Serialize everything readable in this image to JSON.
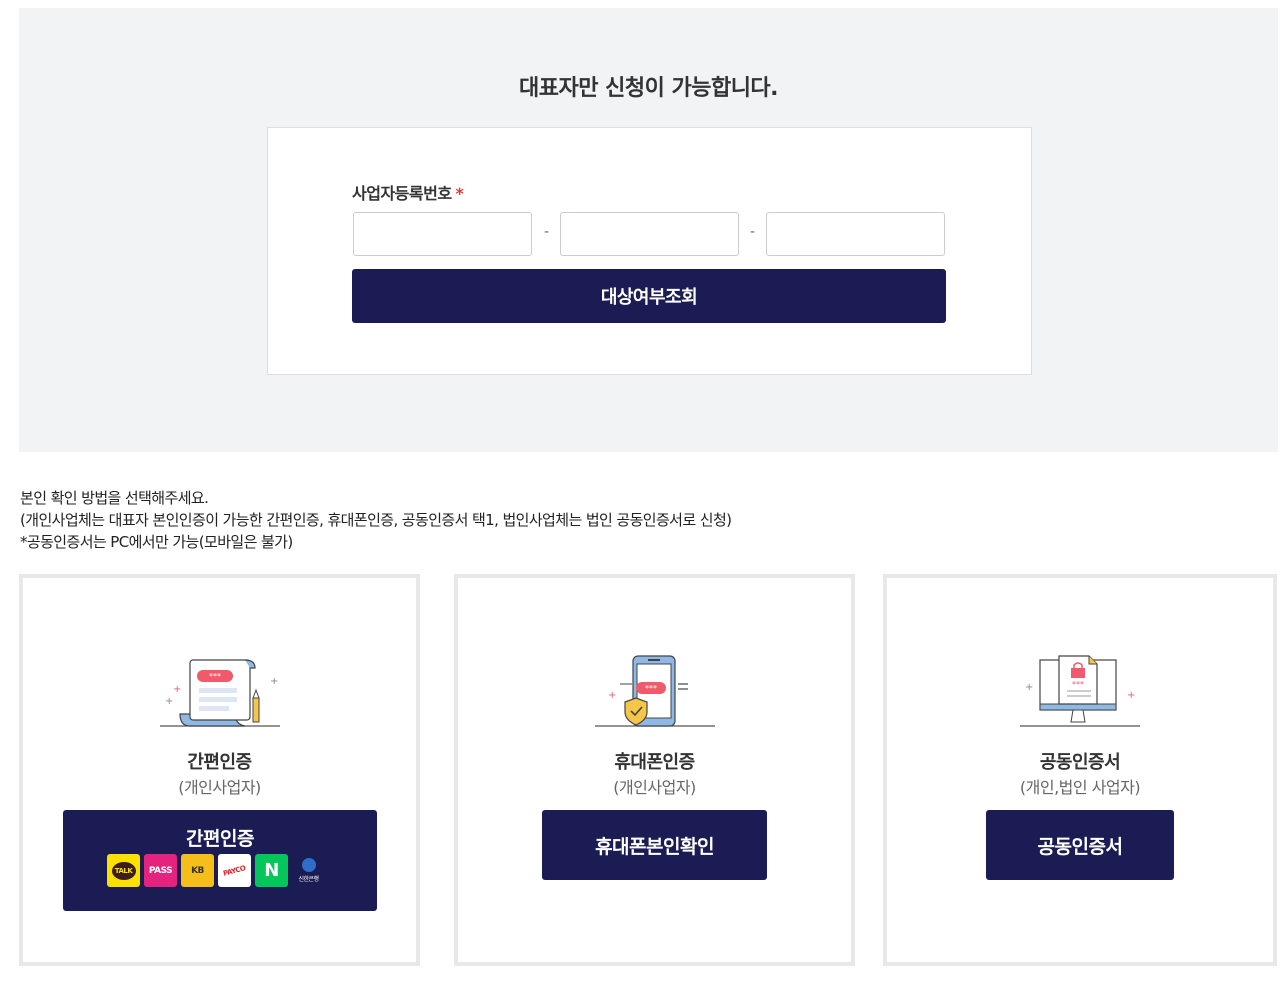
{
  "top": {
    "notice": "대표자만 신청이 가능합니다.",
    "field_label": "사업자등록번호",
    "required_mark": "*",
    "inputs": [
      {
        "value": "",
        "placeholder": ""
      },
      {
        "value": "",
        "placeholder": ""
      },
      {
        "value": "",
        "placeholder": ""
      }
    ],
    "separator": "-",
    "check_button": "대상여부조회"
  },
  "guide": {
    "line1": "본인 확인 방법을 선택해주세요.",
    "line2": "(개인사업체는 대표자 본인인증이 가능한 간편인증, 휴대폰인증, 공동인증서 택1, 법인사업체는 법인 공동인증서로 신청)",
    "line3": "*공동인증서는 PC에서만 가능(모바일은 불가)"
  },
  "methods": [
    {
      "title": "간편인증",
      "subtitle": "(개인사업자)",
      "button": "간편인증",
      "providers": [
        {
          "label": "TALK",
          "icon": "kakaotalk-icon",
          "color": "#fae100"
        },
        {
          "label": "PASS",
          "icon": "pass-icon",
          "color": "#e3237e"
        },
        {
          "label": "KB",
          "icon": "kb-icon",
          "color": "#f6be1a"
        },
        {
          "label": "PAYCO",
          "icon": "payco-icon",
          "color": "#ffffff"
        },
        {
          "label": "N",
          "icon": "naver-icon",
          "color": "#03c75a"
        },
        {
          "label": "신한은행",
          "icon": "shinhan-icon",
          "color": "#1c1c54"
        }
      ]
    },
    {
      "title": "휴대폰인증",
      "subtitle": "(개인사업자)",
      "button": "휴대폰본인확인"
    },
    {
      "title": "공동인증서",
      "subtitle": "(개인,법인 사업자)",
      "button": "공동인증서"
    }
  ],
  "colors": {
    "primary": "#1c1c54",
    "panel_bg": "#f2f3f5",
    "required": "#e33b3b",
    "card_border": "#e7e8ea"
  }
}
